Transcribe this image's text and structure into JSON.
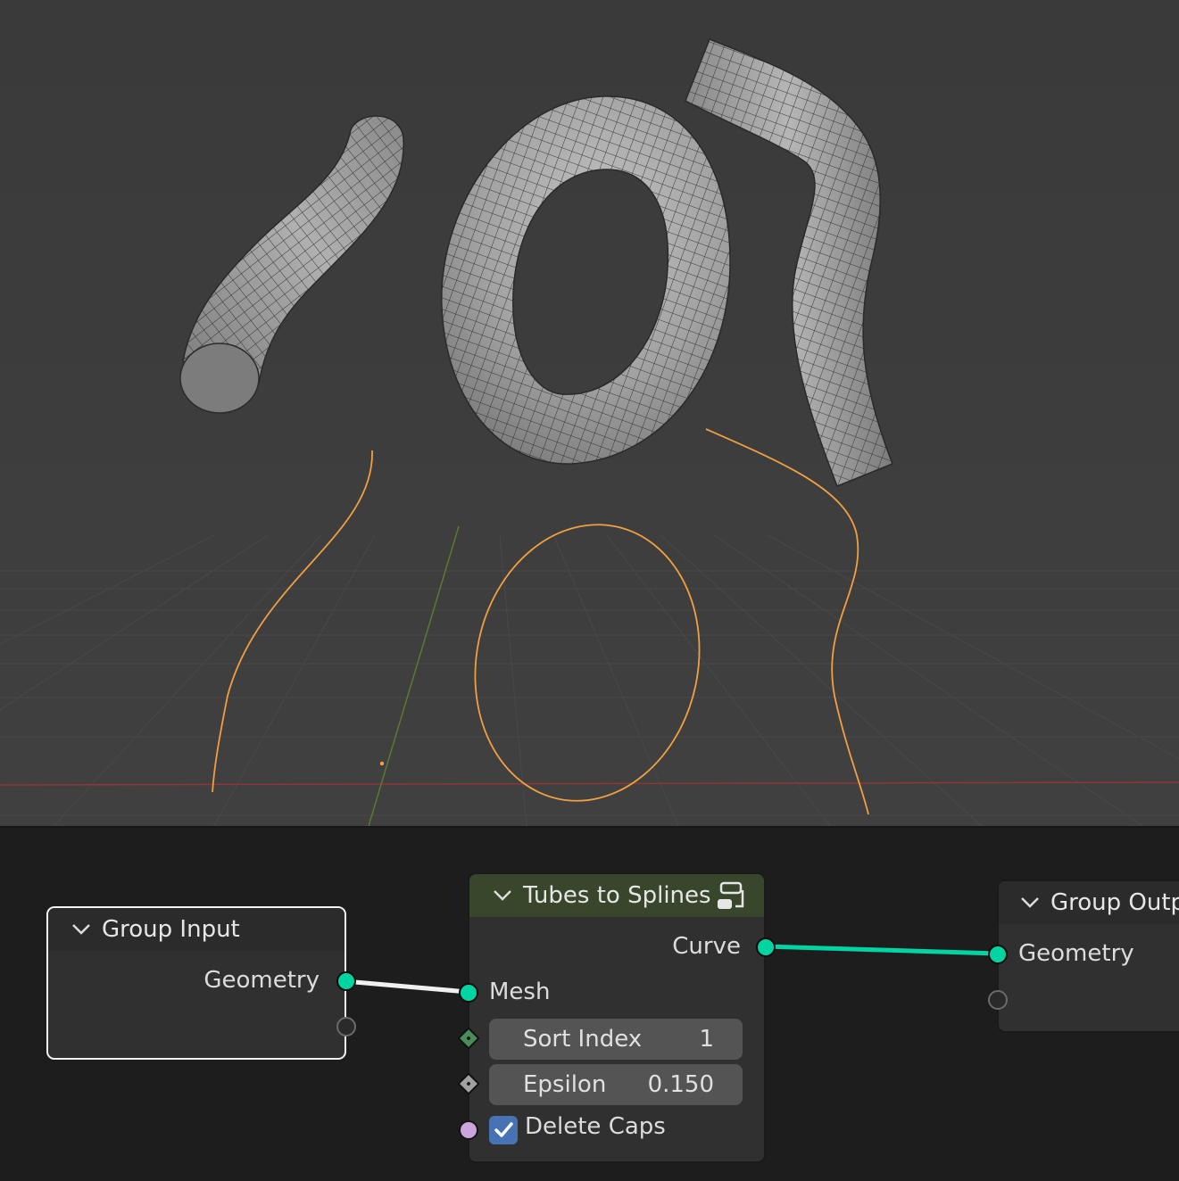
{
  "node_editor": {
    "nodes": {
      "group_input": {
        "title": "Group Input",
        "outputs": {
          "geometry": "Geometry"
        }
      },
      "tubes_to_splines": {
        "title": "Tubes to Splines",
        "outputs": {
          "curve": "Curve"
        },
        "inputs": {
          "mesh": "Mesh",
          "sort_index": {
            "label": "Sort Index",
            "value": "1"
          },
          "epsilon": {
            "label": "Epsilon",
            "value": "0.150"
          },
          "delete_caps": {
            "label": "Delete Caps",
            "checked": true
          }
        },
        "header_color": "#38462b"
      },
      "group_output": {
        "title": "Group Outpu",
        "inputs": {
          "geometry": "Geometry"
        }
      }
    },
    "colors": {
      "geometry_socket": "#00d4a3",
      "boolean_socket": "#cca5dc",
      "integer_socket": "#4c8c5a",
      "float_socket": "#a1a1a1",
      "selected_outline": "#ffffff",
      "checkbox": "#4772b3"
    }
  },
  "viewport": {
    "colors": {
      "background": "#3d3d3d",
      "curve": "#f0a040",
      "x_axis": "#a03a3a",
      "y_axis": "#5f7f2f",
      "mesh": "#a9a9a9"
    }
  }
}
